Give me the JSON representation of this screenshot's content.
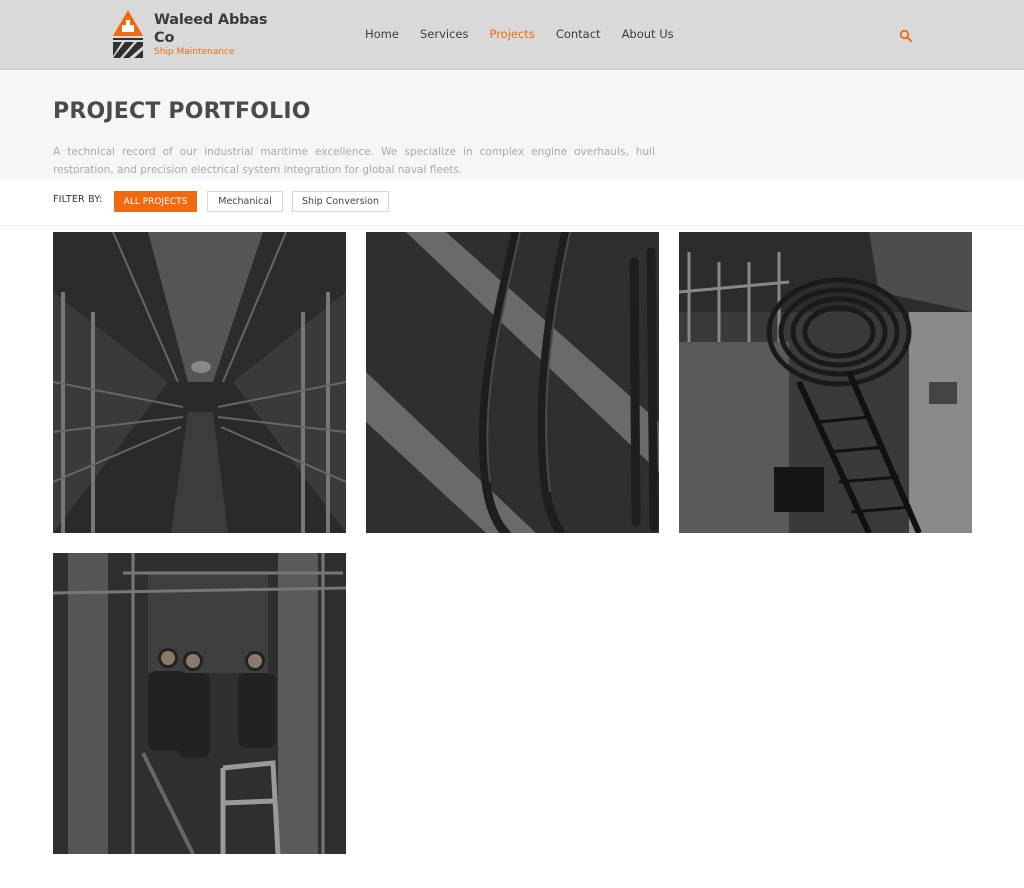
{
  "brand": {
    "name": "Waleed Abbas Co",
    "tagline": "Ship Maintenance",
    "accent_color": "#f26a10"
  },
  "nav": {
    "items": [
      {
        "label": "Home",
        "active": false
      },
      {
        "label": "Services",
        "active": false
      },
      {
        "label": "Projects",
        "active": true
      },
      {
        "label": "Contact",
        "active": false
      },
      {
        "label": "About Us",
        "active": false
      }
    ],
    "search_icon": "search-icon"
  },
  "hero": {
    "title": "PROJECT PORTFOLIO",
    "description": "A technical record of our industrial maritime excellence. We specialize in complex engine overhauls, hull restoration, and precision electrical system integration for global naval fleets."
  },
  "filter": {
    "label": "FILTER BY:",
    "options": [
      {
        "label": "ALL PROJECTS",
        "active": true
      },
      {
        "label": "Mechanical",
        "active": false
      },
      {
        "label": "Ship Conversion",
        "active": false
      }
    ]
  },
  "projects": [
    {
      "image": "ship-walkway-photo"
    },
    {
      "image": "deck-pipes-photo"
    },
    {
      "image": "coiled-pipe-photo"
    },
    {
      "image": "engine-room-crew-photo"
    }
  ]
}
